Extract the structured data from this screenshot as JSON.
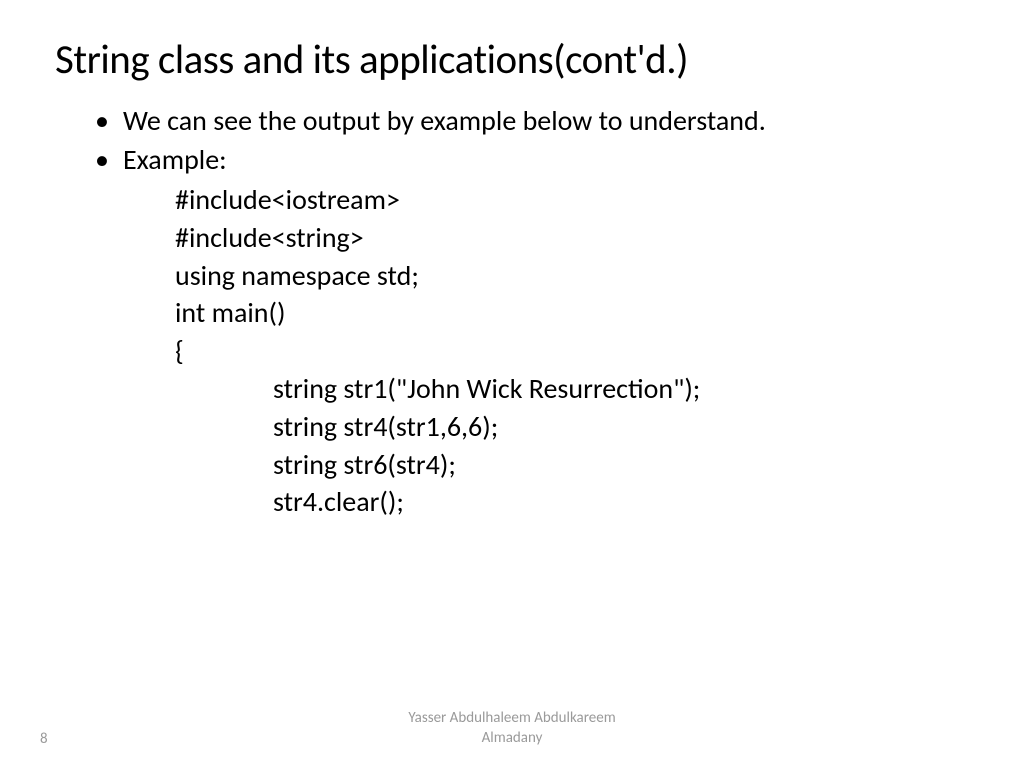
{
  "title": "String class and its applications(cont'd.)",
  "bullets": {
    "item1": "We can see the output by example below to understand.",
    "item2": "Example:"
  },
  "code": {
    "line1": "#include<iostream>",
    "line2": "#include<string>",
    "line3": "using namespace std;",
    "line4": "int main()",
    "line5": "{",
    "line6": "string str1(\"John Wick Resurrection\");",
    "line7": "string str4(str1,6,6);",
    "line8": "string str6(str4);",
    "line9": "str4.clear();"
  },
  "footer": {
    "page": "8",
    "author_line1": "Yasser Abdulhaleem Abdulkareem",
    "author_line2": "Almadany"
  }
}
